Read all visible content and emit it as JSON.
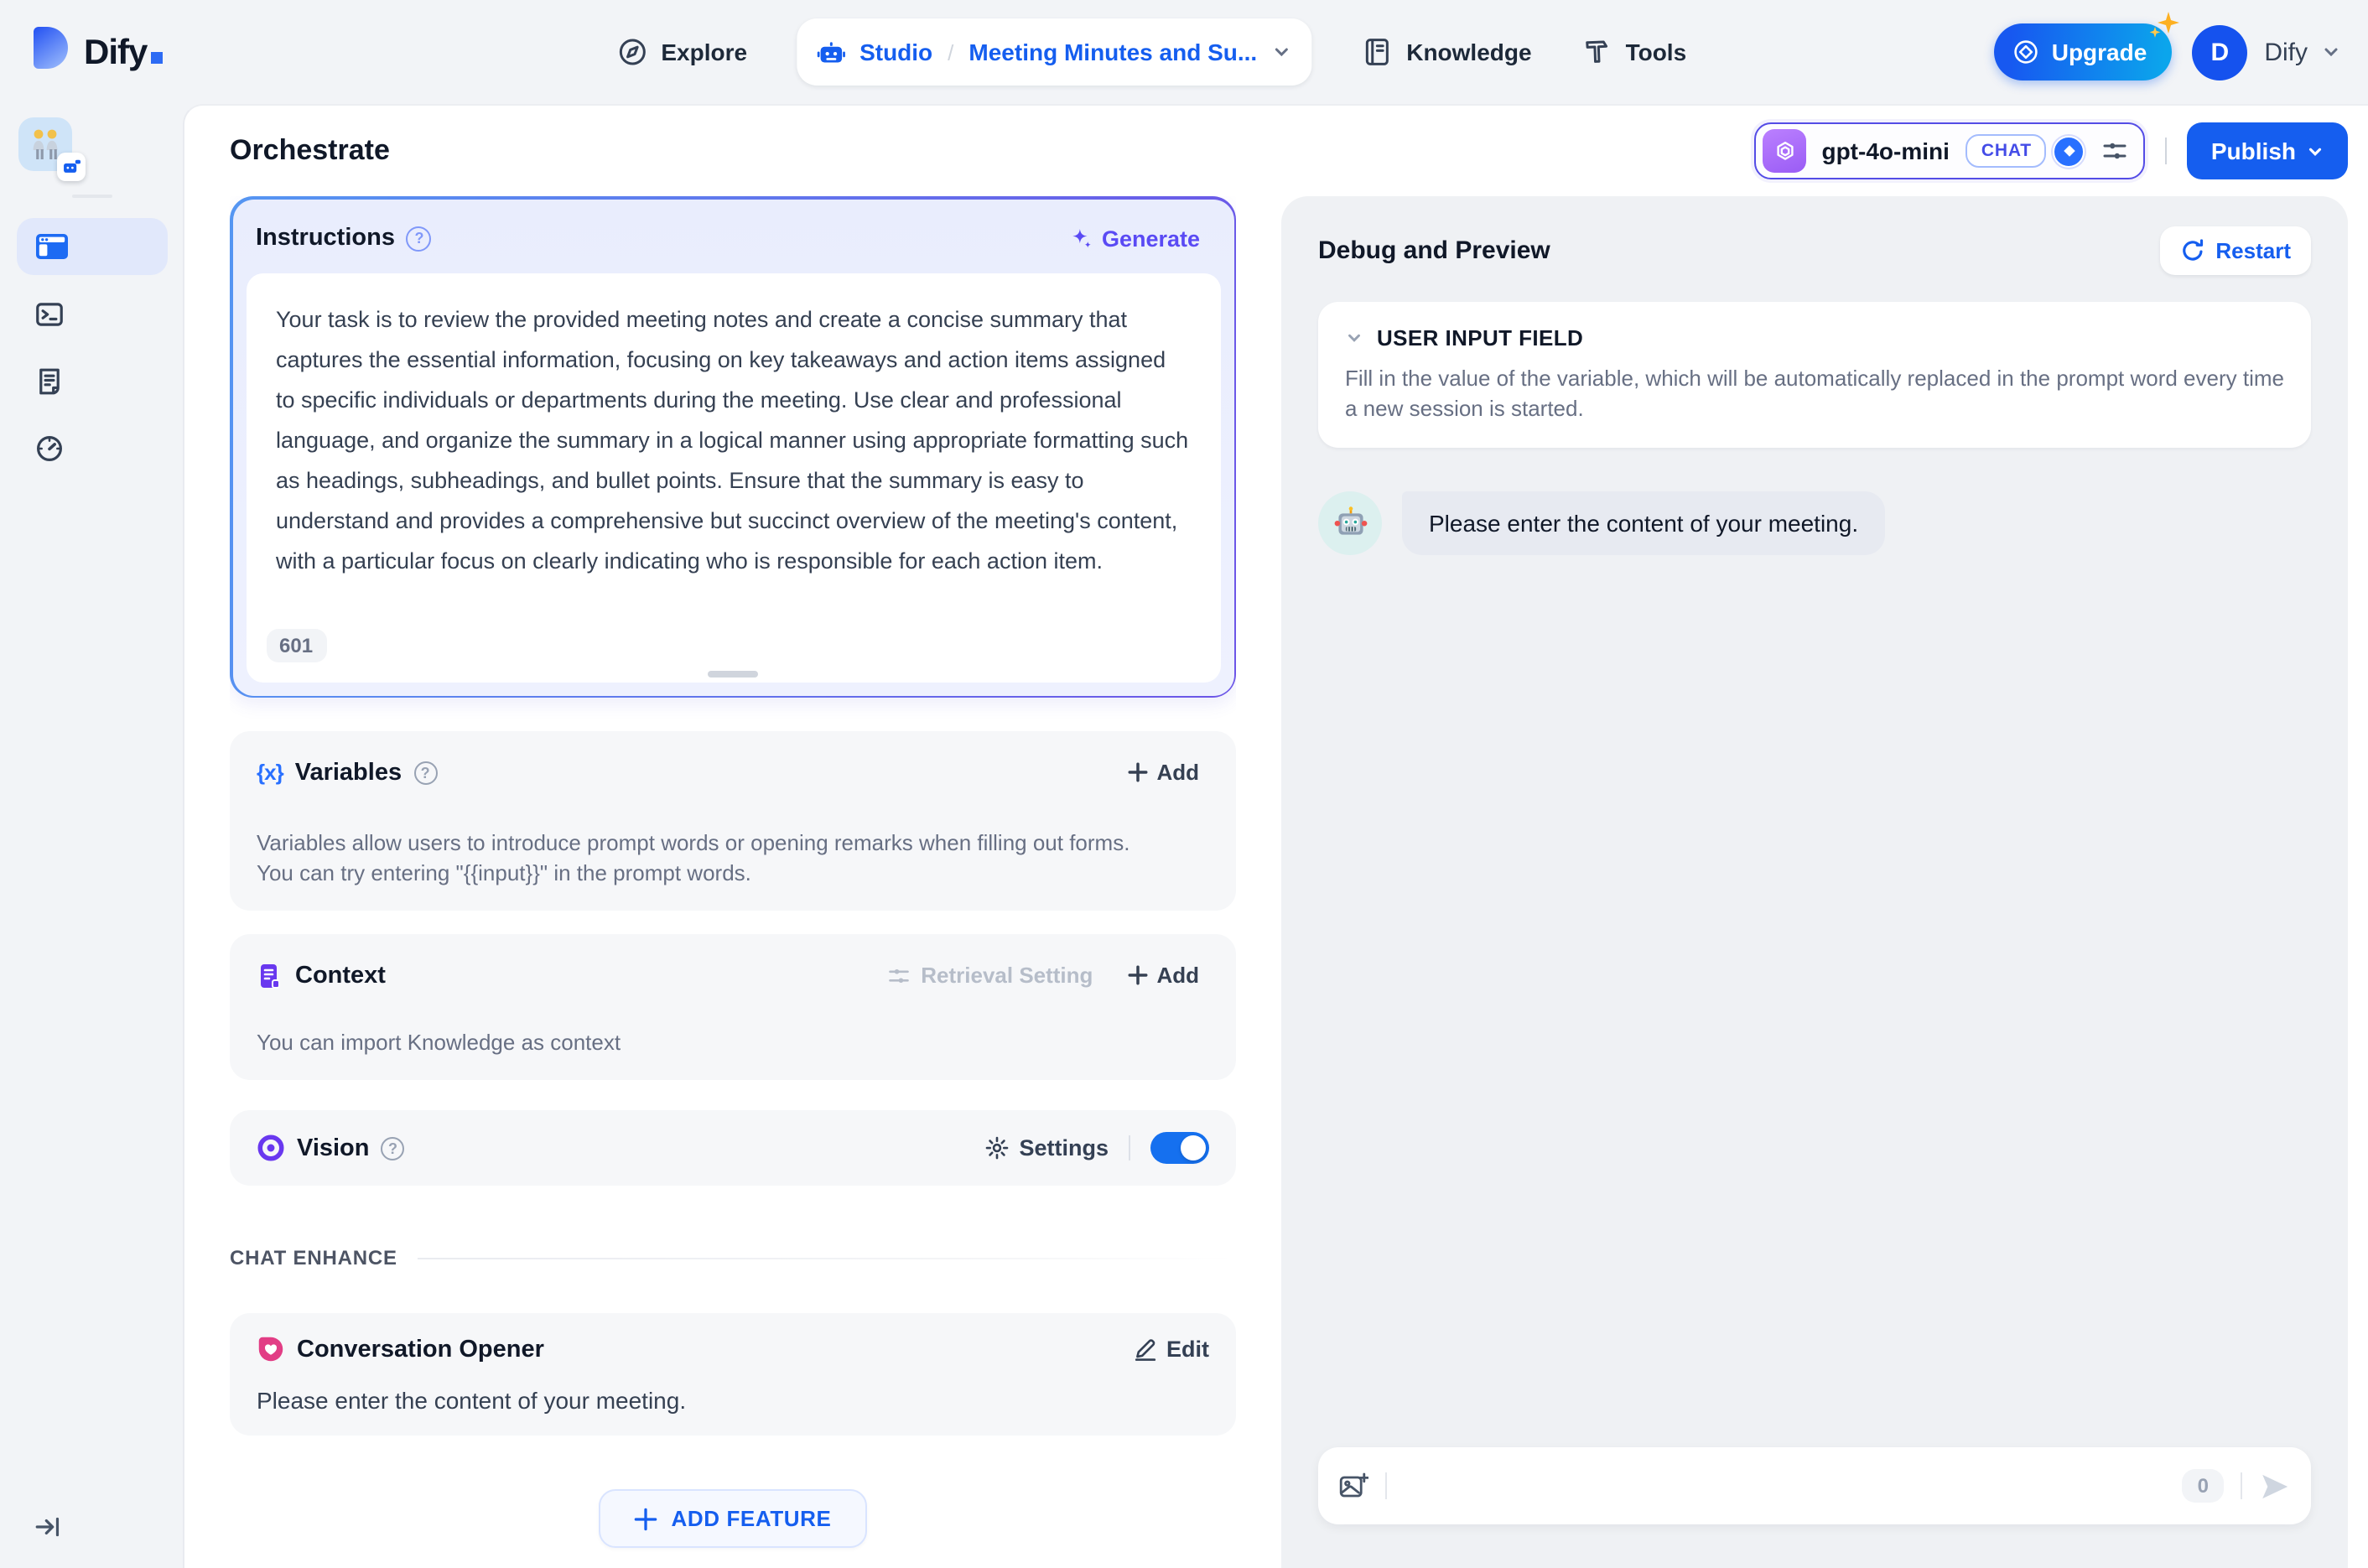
{
  "colors": {
    "primary_blue": "#155eef",
    "indigo_accent": "#444ce7",
    "purple_accent": "#6938ef",
    "pink_accent": "#e23d85",
    "page_background": "#f2f4f7",
    "debug_panel_background": "#eff1f4",
    "instructions_border_gradient": [
      "#5596f2",
      "#6c55e7"
    ]
  },
  "icons": {
    "logo_mark": "dify-d-shape",
    "explore": "compass",
    "studio": "robot-head",
    "knowledge": "book",
    "tools": "hammer",
    "upgrade": "gem-circle",
    "sidebar_active": "app-window",
    "sidebar_2": "terminal",
    "sidebar_3": "logs",
    "sidebar_4": "gauge",
    "model_provider": "openai-knot",
    "generate": "four-point-star",
    "variables": "curly-braces-x",
    "context": "purple-document",
    "vision": "purple-eye",
    "opener": "pink-chat-heart",
    "restart": "refresh-arrow",
    "chat_upload": "image-plus",
    "send": "paper-plane"
  },
  "header": {
    "logo_text": "Dify",
    "nav_explore": "Explore",
    "nav_knowledge": "Knowledge",
    "nav_tools": "Tools",
    "breadcrumb": {
      "studio": "Studio",
      "separator": "/",
      "app_name": "Meeting Minutes and Su..."
    },
    "upgrade_label": "Upgrade",
    "account": {
      "initial": "D",
      "name": "Dify"
    }
  },
  "toolbar": {
    "page_title": "Orchestrate",
    "model": {
      "name": "gpt-4o-mini",
      "mode": "CHAT"
    },
    "publish_label": "Publish"
  },
  "config": {
    "instructions": {
      "title": "Instructions",
      "generate_label": "Generate",
      "body": "Your task is to review the provided meeting notes and create a concise summary that captures the essential information, focusing on key takeaways and action items assigned to specific individuals or departments during the meeting. Use clear and professional language, and organize the summary in a logical manner using appropriate formatting such as headings, subheadings, and bullet points. Ensure that the summary is easy to understand and provides a comprehensive but succinct overview of the meeting's content, with a particular focus on clearly indicating who is responsible for each action item.",
      "char_count": "601"
    },
    "variables": {
      "title": "Variables",
      "add_label": "Add",
      "description": "Variables allow users to introduce prompt words or opening remarks when filling out forms. You can try entering \"{{input}}\" in the prompt words."
    },
    "context": {
      "title": "Context",
      "retrieval_label": "Retrieval Setting",
      "add_label": "Add",
      "description": "You can import Knowledge as context"
    },
    "vision": {
      "title": "Vision",
      "settings_label": "Settings",
      "enabled": true
    },
    "chat_enhance_label": "CHAT ENHANCE",
    "opener": {
      "title": "Conversation Opener",
      "edit_label": "Edit",
      "message": "Please enter the content of your meeting."
    },
    "add_feature_label": "ADD FEATURE"
  },
  "debug": {
    "title": "Debug and Preview",
    "restart_label": "Restart",
    "user_input_field": {
      "title": "USER INPUT FIELD",
      "description": "Fill in the value of the variable, which will be automatically replaced in the prompt word every time a new session is started."
    },
    "bot_message": "Please enter the content of your meeting.",
    "input": {
      "char_count": "0"
    }
  }
}
